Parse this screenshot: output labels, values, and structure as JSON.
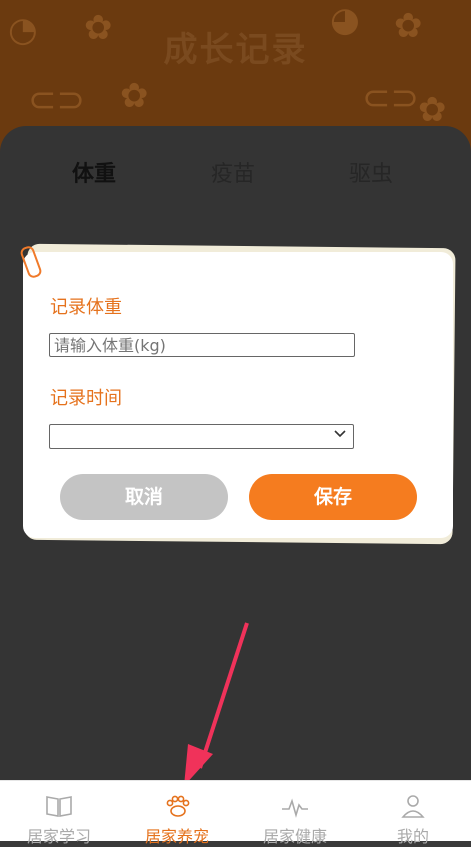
{
  "header": {
    "title": "成长记录"
  },
  "tabs": [
    {
      "label": "体重",
      "active": true
    },
    {
      "label": "疫苗",
      "active": false
    },
    {
      "label": "驱虫",
      "active": false
    }
  ],
  "dialog": {
    "weight_label": "记录体重",
    "weight_placeholder": "请输入体重(kg)",
    "weight_value": "",
    "time_label": "记录时间",
    "time_selected": "",
    "cancel_label": "取消",
    "save_label": "保存"
  },
  "nav": [
    {
      "label": "居家学习",
      "icon": "book-icon",
      "active": false
    },
    {
      "label": "居家养宠",
      "icon": "paw-icon",
      "active": true
    },
    {
      "label": "居家健康",
      "icon": "pulse-icon",
      "active": false
    },
    {
      "label": "我的",
      "icon": "user-icon",
      "active": false
    }
  ],
  "colors": {
    "accent": "#f57c1f",
    "label": "#e5721d",
    "cancel": "#c4c4c4",
    "arrow": "#f0325a"
  }
}
